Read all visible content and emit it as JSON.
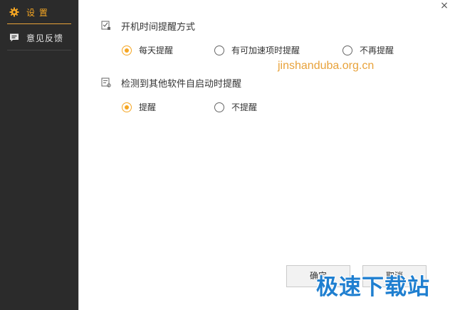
{
  "sidebar": {
    "items": [
      {
        "label": "设 置",
        "icon": "gear-icon",
        "active": true
      },
      {
        "label": "意见反馈",
        "icon": "feedback-icon",
        "active": false
      }
    ]
  },
  "window": {
    "close_glyph": "×"
  },
  "sections": [
    {
      "title": "开机时间提醒方式",
      "options": [
        "每天提醒",
        "有可加速项时提醒",
        "不再提醒"
      ],
      "selected": "每天提醒"
    },
    {
      "title": "检测到其他软件自启动时提醒",
      "options": [
        "提醒",
        "不提醒"
      ],
      "selected": "提醒"
    }
  ],
  "watermark_text": "jinshanduba.org.cn",
  "buttons": {
    "confirm": "确定",
    "cancel": "取消"
  },
  "logo_watermark": "极速下载站",
  "colors": {
    "accent": "#f5a623",
    "sidebar_bg": "#2b2b2b",
    "watermark": "#e8a23a",
    "logo": "#1f7fd0"
  }
}
